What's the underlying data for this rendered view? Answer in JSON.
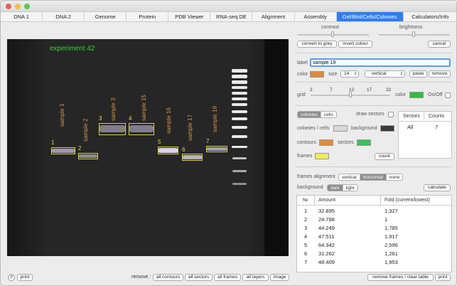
{
  "window": {
    "traffic_colors": [
      "#ee5f57",
      "#f6be4f",
      "#61c554"
    ]
  },
  "tabs": [
    {
      "label": "DNA 1"
    },
    {
      "label": "DNA 2"
    },
    {
      "label": "Genome"
    },
    {
      "label": "Protein"
    },
    {
      "label": "PDB Viewer"
    },
    {
      "label": "RNA-seq DE"
    },
    {
      "label": "Alignment"
    },
    {
      "label": "Assembly"
    },
    {
      "label": "Gel/Blot/Cells/Colonies",
      "active": true
    },
    {
      "label": "Calculators/Info"
    }
  ],
  "gel": {
    "experiment_label": "experiment 42",
    "lane_labels": [
      "sample 1",
      "sample 2",
      "sample 3",
      "sample 15",
      "sample 16",
      "sample 17",
      "sample 19"
    ],
    "band_numbers": [
      "1",
      "2",
      "3",
      "4",
      "5",
      "6",
      "7"
    ]
  },
  "adjust": {
    "contrast_label": "contrast",
    "brightness_label": "brightness",
    "convert_grey": "convert to grey",
    "invert_colour": "invert colour",
    "cancel": "cancel"
  },
  "label_section": {
    "label_caption": "label",
    "label_value": "sample 19",
    "color_caption": "color",
    "color_value": "#e08a3c",
    "size_caption": "size",
    "size_value": "14",
    "orientation_value": "vertical",
    "paste": "paste",
    "remove": "remove"
  },
  "grid": {
    "caption": "grid",
    "ticks": [
      "2",
      "7",
      "12",
      "17",
      "22"
    ],
    "color_caption": "color",
    "color_value": "#2fbf45",
    "onoff_label": "On/Off"
  },
  "colonies": {
    "mode_options": [
      "colonies",
      "cells"
    ],
    "mode_selected": "colonies",
    "draw_sectors": "draw sectors",
    "colonies_cells_caption": "colonies / cells",
    "colonies_cells_color": "#d8d8d8",
    "background_caption": "background",
    "background_color": "#3a3a3a",
    "contours_caption": "contours",
    "contours_color": "#e08a3c",
    "sectors_caption": "sectors",
    "sectors_color": "#3fbf5a",
    "frames_caption": "frames",
    "frames_color": "#f1ea58",
    "count_button": "count",
    "sectors_table_header": [
      "Sectors",
      "Counts"
    ],
    "sectors_table_rows": [
      {
        "sector": "All",
        "count": "7"
      }
    ]
  },
  "frames": {
    "alignment_caption": "frames alignment",
    "alignment_options": [
      "vertical",
      "horizontal",
      "none"
    ],
    "alignment_selected": "horizontal",
    "background_caption": "background",
    "background_options": [
      "dark",
      "light"
    ],
    "background_selected": "dark",
    "calculate": "calculate"
  },
  "results": {
    "headers": [
      "№",
      "Amount",
      "Fold (current/lowest)"
    ],
    "rows": [
      {
        "n": "1",
        "amount": "32.895",
        "fold": "1,327"
      },
      {
        "n": "2",
        "amount": "24.788",
        "fold": "1"
      },
      {
        "n": "3",
        "amount": "44.249",
        "fold": "1,785"
      },
      {
        "n": "4",
        "amount": "47.511",
        "fold": "1,917"
      },
      {
        "n": "5",
        "amount": "64.342",
        "fold": "2,596"
      },
      {
        "n": "6",
        "amount": "31.262",
        "fold": "1,261"
      },
      {
        "n": "7",
        "amount": "48.409",
        "fold": "1,953"
      }
    ]
  },
  "footer": {
    "help": "?",
    "print": "print",
    "remove_caption": "remove :",
    "all_contours": "all contours",
    "all_sectors": "all sectors",
    "all_frames": "all frames",
    "all_layers": "all layers",
    "image": "image",
    "remove_frames": "remove frames / clear table",
    "print_right": "print"
  }
}
